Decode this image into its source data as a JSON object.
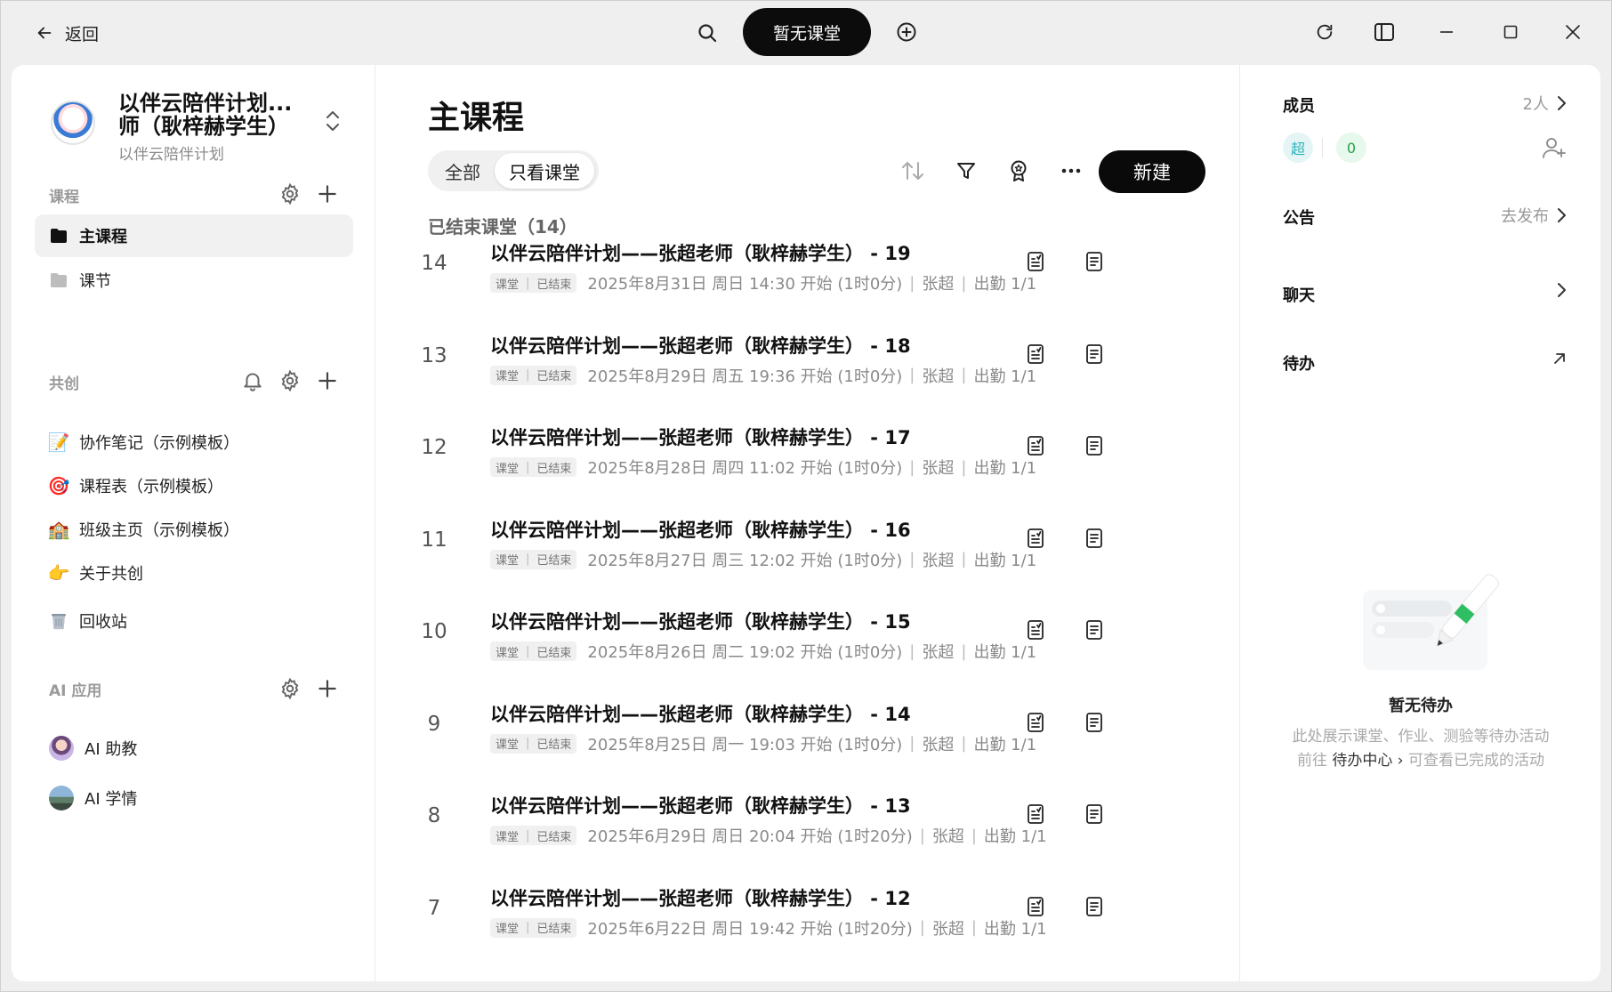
{
  "titlebar": {
    "back_label": "返回",
    "no_class_label": "暂无课堂"
  },
  "org": {
    "name": "以伴云陪伴计划... 师（耿梓赫学生）",
    "sub": "以伴云陪伴计划"
  },
  "sidebar": {
    "courses_label": "课程",
    "course_items": [
      {
        "label": "主课程",
        "icon": "folder-icon",
        "active": true
      },
      {
        "label": "课节",
        "icon": "folder-icon",
        "active": false
      }
    ],
    "cocreate_label": "共创",
    "cocreate_items": [
      {
        "label": "协作笔记（示例模板）",
        "icon": "memo-icon",
        "glyph": "📝"
      },
      {
        "label": "课程表（示例模板）",
        "icon": "target-icon",
        "glyph": "🎯"
      },
      {
        "label": "班级主页（示例模板）",
        "icon": "school-icon",
        "glyph": "🏫"
      },
      {
        "label": "关于共创",
        "icon": "pointing-hand-icon",
        "glyph": "👉"
      },
      {
        "label": "回收站",
        "icon": "trash-icon",
        "glyph": "🗑️"
      }
    ],
    "ai_label": "AI 应用",
    "ai_items": [
      {
        "label": "AI 助教",
        "icon": "ai-assistant-avatar"
      },
      {
        "label": "AI 学情",
        "icon": "ai-analytics-avatar"
      }
    ]
  },
  "main": {
    "title": "主课程",
    "filter_all": "全部",
    "filter_classes": "只看课堂",
    "new_button": "新建",
    "group_label": "已结束课堂（14）",
    "tag_class": "课堂",
    "tag_ended": "已结束",
    "rows": [
      {
        "num": "14",
        "title": "以伴云陪伴计划——张超老师（耿梓赫学生） - 19",
        "time": "2025年8月31日 周日 14:30 开始 (1时0分)",
        "teacher": "张超",
        "attendance": "出勤 1/1"
      },
      {
        "num": "13",
        "title": "以伴云陪伴计划——张超老师（耿梓赫学生） - 18",
        "time": "2025年8月29日 周五 19:36 开始 (1时0分)",
        "teacher": "张超",
        "attendance": "出勤 1/1"
      },
      {
        "num": "12",
        "title": "以伴云陪伴计划——张超老师（耿梓赫学生） - 17",
        "time": "2025年8月28日 周四 11:02 开始 (1时0分)",
        "teacher": "张超",
        "attendance": "出勤 1/1"
      },
      {
        "num": "11",
        "title": "以伴云陪伴计划——张超老师（耿梓赫学生） - 16",
        "time": "2025年8月27日 周三 12:02 开始 (1时0分)",
        "teacher": "张超",
        "attendance": "出勤 1/1"
      },
      {
        "num": "10",
        "title": "以伴云陪伴计划——张超老师（耿梓赫学生） - 15",
        "time": "2025年8月26日 周二 19:02 开始 (1时0分)",
        "teacher": "张超",
        "attendance": "出勤 1/1"
      },
      {
        "num": "9",
        "title": "以伴云陪伴计划——张超老师（耿梓赫学生） - 14",
        "time": "2025年8月25日 周一 19:03 开始 (1时0分)",
        "teacher": "张超",
        "attendance": "出勤 1/1"
      },
      {
        "num": "8",
        "title": "以伴云陪伴计划——张超老师（耿梓赫学生） - 13",
        "time": "2025年6月29日 周日 20:04 开始 (1时20分)",
        "teacher": "张超",
        "attendance": "出勤 1/1"
      },
      {
        "num": "7",
        "title": "以伴云陪伴计划——张超老师（耿梓赫学生） - 12",
        "time": "2025年6月22日 周日 19:42 开始 (1时20分)",
        "teacher": "张超",
        "attendance": "出勤 1/1"
      }
    ]
  },
  "right": {
    "members_label": "成员",
    "members_count": "2人",
    "member_chip": "超",
    "member_zero": "0",
    "notice_label": "公告",
    "notice_action": "去发布",
    "chat_label": "聊天",
    "todo_label": "待办",
    "empty_title": "暂无待办",
    "empty_desc_line1": "此处展示课堂、作业、测验等待办活动",
    "empty_desc_prefix": "前往 ",
    "empty_desc_link": "待办中心",
    "empty_desc_suffix": "可查看已完成的活动"
  },
  "colors": {
    "accent": "#0a0a0a",
    "chip_teal": "#2bb3b8",
    "chip_green": "#21a34a"
  }
}
